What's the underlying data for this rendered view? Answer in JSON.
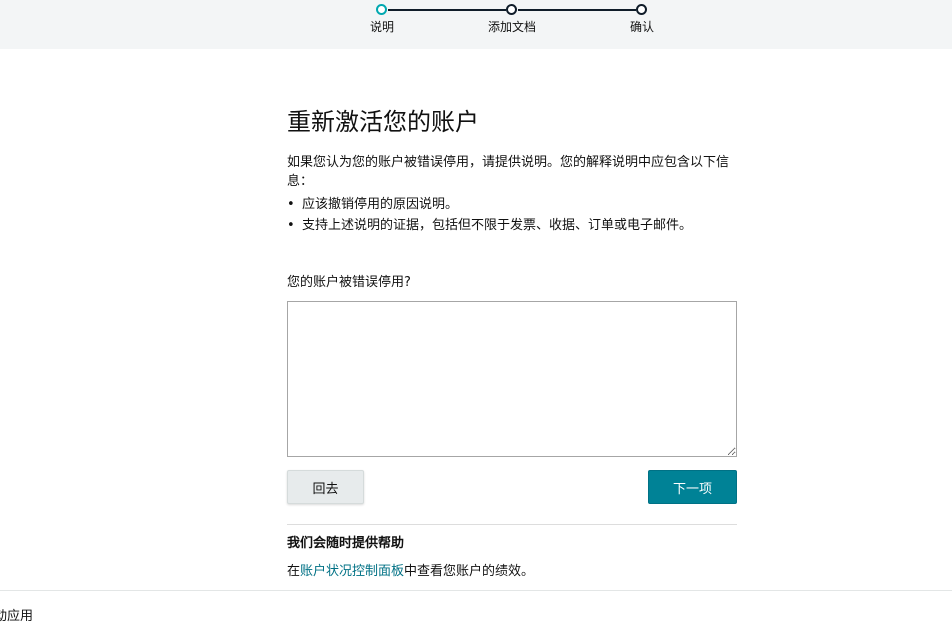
{
  "stepper": {
    "steps": [
      {
        "label": "说明",
        "state": "current"
      },
      {
        "label": "添加文档",
        "state": "pending"
      },
      {
        "label": "确认",
        "state": "pending"
      }
    ],
    "active_color": "#00a8b0",
    "line_color": "#0f1c29"
  },
  "page": {
    "title": "重新激活您的账户",
    "intro": "如果您认为您的账户被错误停用，请提供说明。您的解释说明中应包含以下信息：",
    "bullets": [
      "应该撤销停用的原因说明。",
      "支持上述说明的证据，包括但不限于发票、收据、订单或电子邮件。"
    ]
  },
  "form": {
    "question_label": "您的账户被错误停用?",
    "explanation_value": "",
    "back_label": "回去",
    "next_label": "下一项",
    "next_color": "#008296"
  },
  "help": {
    "title": "我们会随时提供帮助",
    "text_prefix": "在",
    "link_text": "账户状况控制面板",
    "text_suffix": "中查看您账户的绩效。"
  },
  "footer": {
    "text": "动应用"
  }
}
